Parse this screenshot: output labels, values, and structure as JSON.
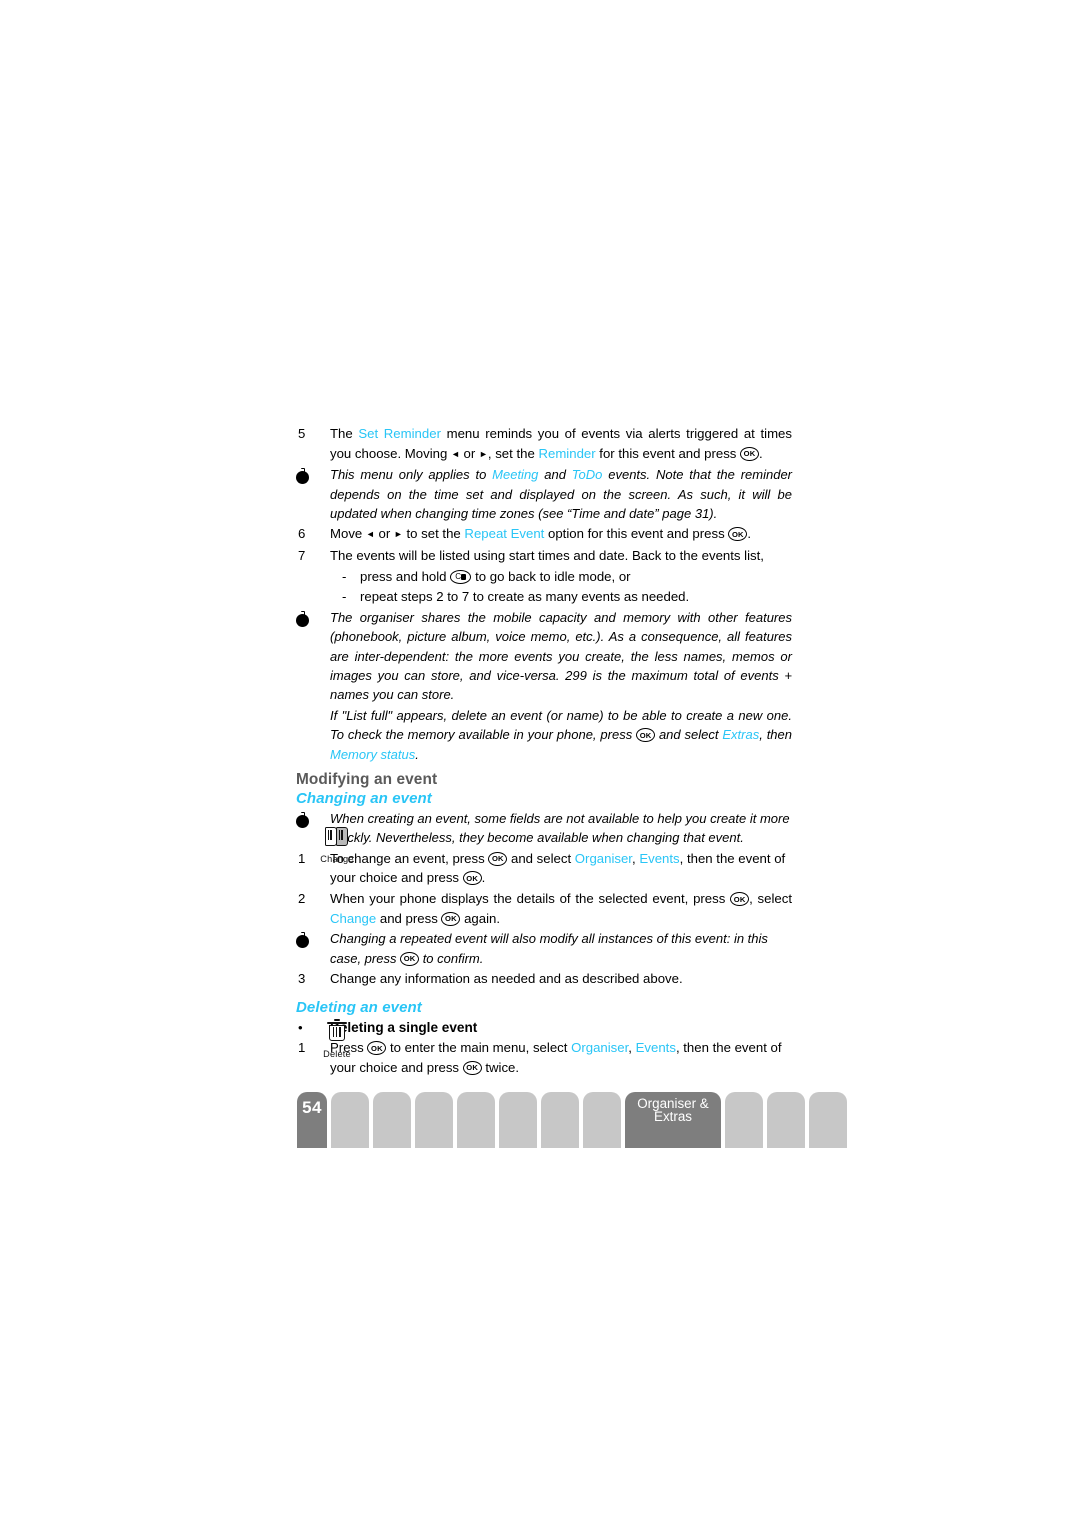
{
  "page": {
    "number": "54",
    "section_line1": "Organiser &",
    "section_line2": "Extras",
    "accent_color": "#29c5f6",
    "heading_color": "#5a5a5a",
    "tab_light_color": "#c7c7c7",
    "tab_dark_color": "#7e7e7e"
  },
  "steps": {
    "s5": {
      "marker": "5",
      "t1": "The ",
      "link1": "Set Reminder",
      "t2": " menu reminds you of events via alerts triggered at times you choose. Moving ",
      "t3": " or ",
      "t4": ", set the ",
      "link2": "Reminder",
      "t5": " for this event and press ",
      "t6": "."
    },
    "note1": {
      "t1": "This menu only applies to ",
      "link1": "Meeting",
      "t2": " and ",
      "link2": "ToDo",
      "t3": " events. Note that the reminder depends on the time set and displayed on the screen. As such, it will be updated when changing time zones (see “Time and date” page 31)."
    },
    "s6": {
      "marker": "6",
      "t1": "Move ",
      "t2": " or ",
      "t3": " to set the ",
      "link1": "Repeat Event",
      "t4": " option for this event and press ",
      "t5": "."
    },
    "s7": {
      "marker": "7",
      "t1": "The events will be listed using start times and date. Back to the events list,"
    },
    "s7a": {
      "marker": "-",
      "t1": "press and hold ",
      "t2": " to go back to idle mode, or"
    },
    "s7b": {
      "marker": "-",
      "t1": "repeat steps 2 to 7 to create as many events as needed."
    },
    "note2": {
      "t1": "The organiser shares the mobile capacity and memory with other features (phonebook, picture album, voice memo, etc.). As a consequence, all features are inter-dependent: the more events you create, the less names, memos or images you can store, and vice-versa. 299 is the maximum total of events + names you can store."
    },
    "note3": {
      "t1": "If \"List full\" appears, delete an event (or name) to be able to create a new one. To check the memory available in your phone, press ",
      "t2": " and select ",
      "link1": "Extras",
      "t3": ", then ",
      "link2": "Memory status",
      "t4": "."
    }
  },
  "modifying": {
    "heading": "Modifying an event",
    "subheading": "Changing an event",
    "icon_label": "Change",
    "note": {
      "t1": "When creating an event, some fields are not available to help you create it more quickly.  Nevertheless, they become available when changing that event."
    },
    "m1": {
      "marker": "1",
      "t1": "To change an event, press ",
      "t2": " and select ",
      "link1": "Organiser",
      "t3": ", ",
      "link2": "Events",
      "t4": ", then the event of your choice and press ",
      "t5": "."
    },
    "m2": {
      "marker": "2",
      "t1": "When your phone displays the details of the selected event, press ",
      "t2": ", select ",
      "link1": "Change",
      "t3": " and press ",
      "t4": " again."
    },
    "note2": {
      "t1": "Changing a repeated event will also modify all instances of this event: in this case, press ",
      "t2": " to confirm."
    },
    "m3": {
      "marker": "3",
      "t1": "Change any information as needed and as described above."
    }
  },
  "deleting": {
    "subheading": "Deleting an event",
    "icon_label": "Delete",
    "bullet_marker": "•",
    "bullet_title": "Deleting a single event",
    "d1": {
      "marker": "1",
      "t1": "Press ",
      "t2": " to enter the main menu, select ",
      "link1": "Organiser",
      "t3": ", ",
      "link2": "Events",
      "t4": ", then the event of your choice and press ",
      "t5": " twice."
    }
  },
  "glyphs": {
    "ok_key": "OK",
    "c_key": "C",
    "left_arrow": "◄",
    "right_arrow": "►"
  }
}
